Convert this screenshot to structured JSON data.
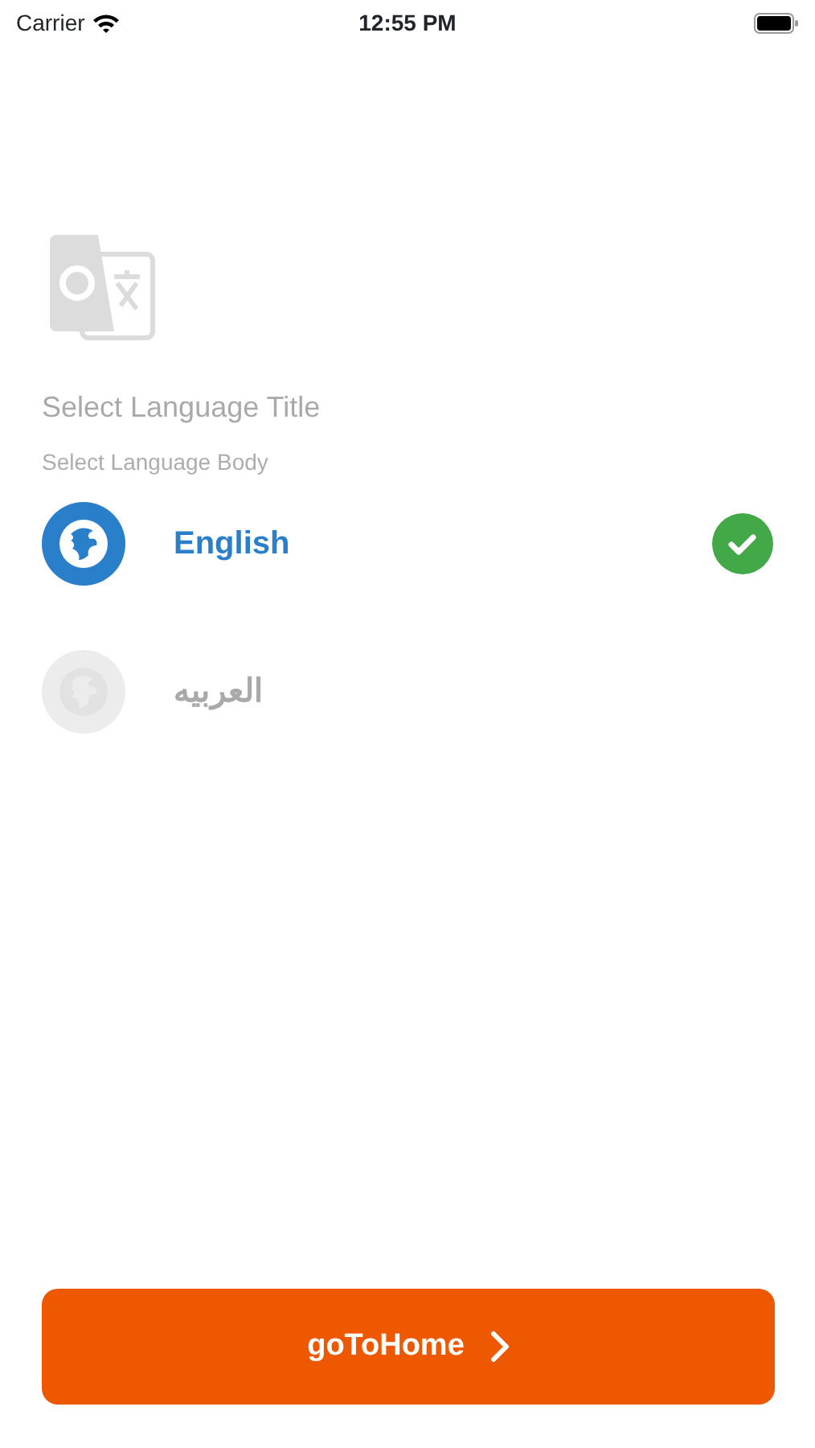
{
  "status_bar": {
    "carrier": "Carrier",
    "time": "12:55 PM"
  },
  "title": "Select Language Title",
  "body": "Select Language Body",
  "languages": [
    {
      "label": "English",
      "selected": true
    },
    {
      "label": "العربيه",
      "selected": false
    }
  ],
  "button": {
    "label": "goToHome"
  }
}
